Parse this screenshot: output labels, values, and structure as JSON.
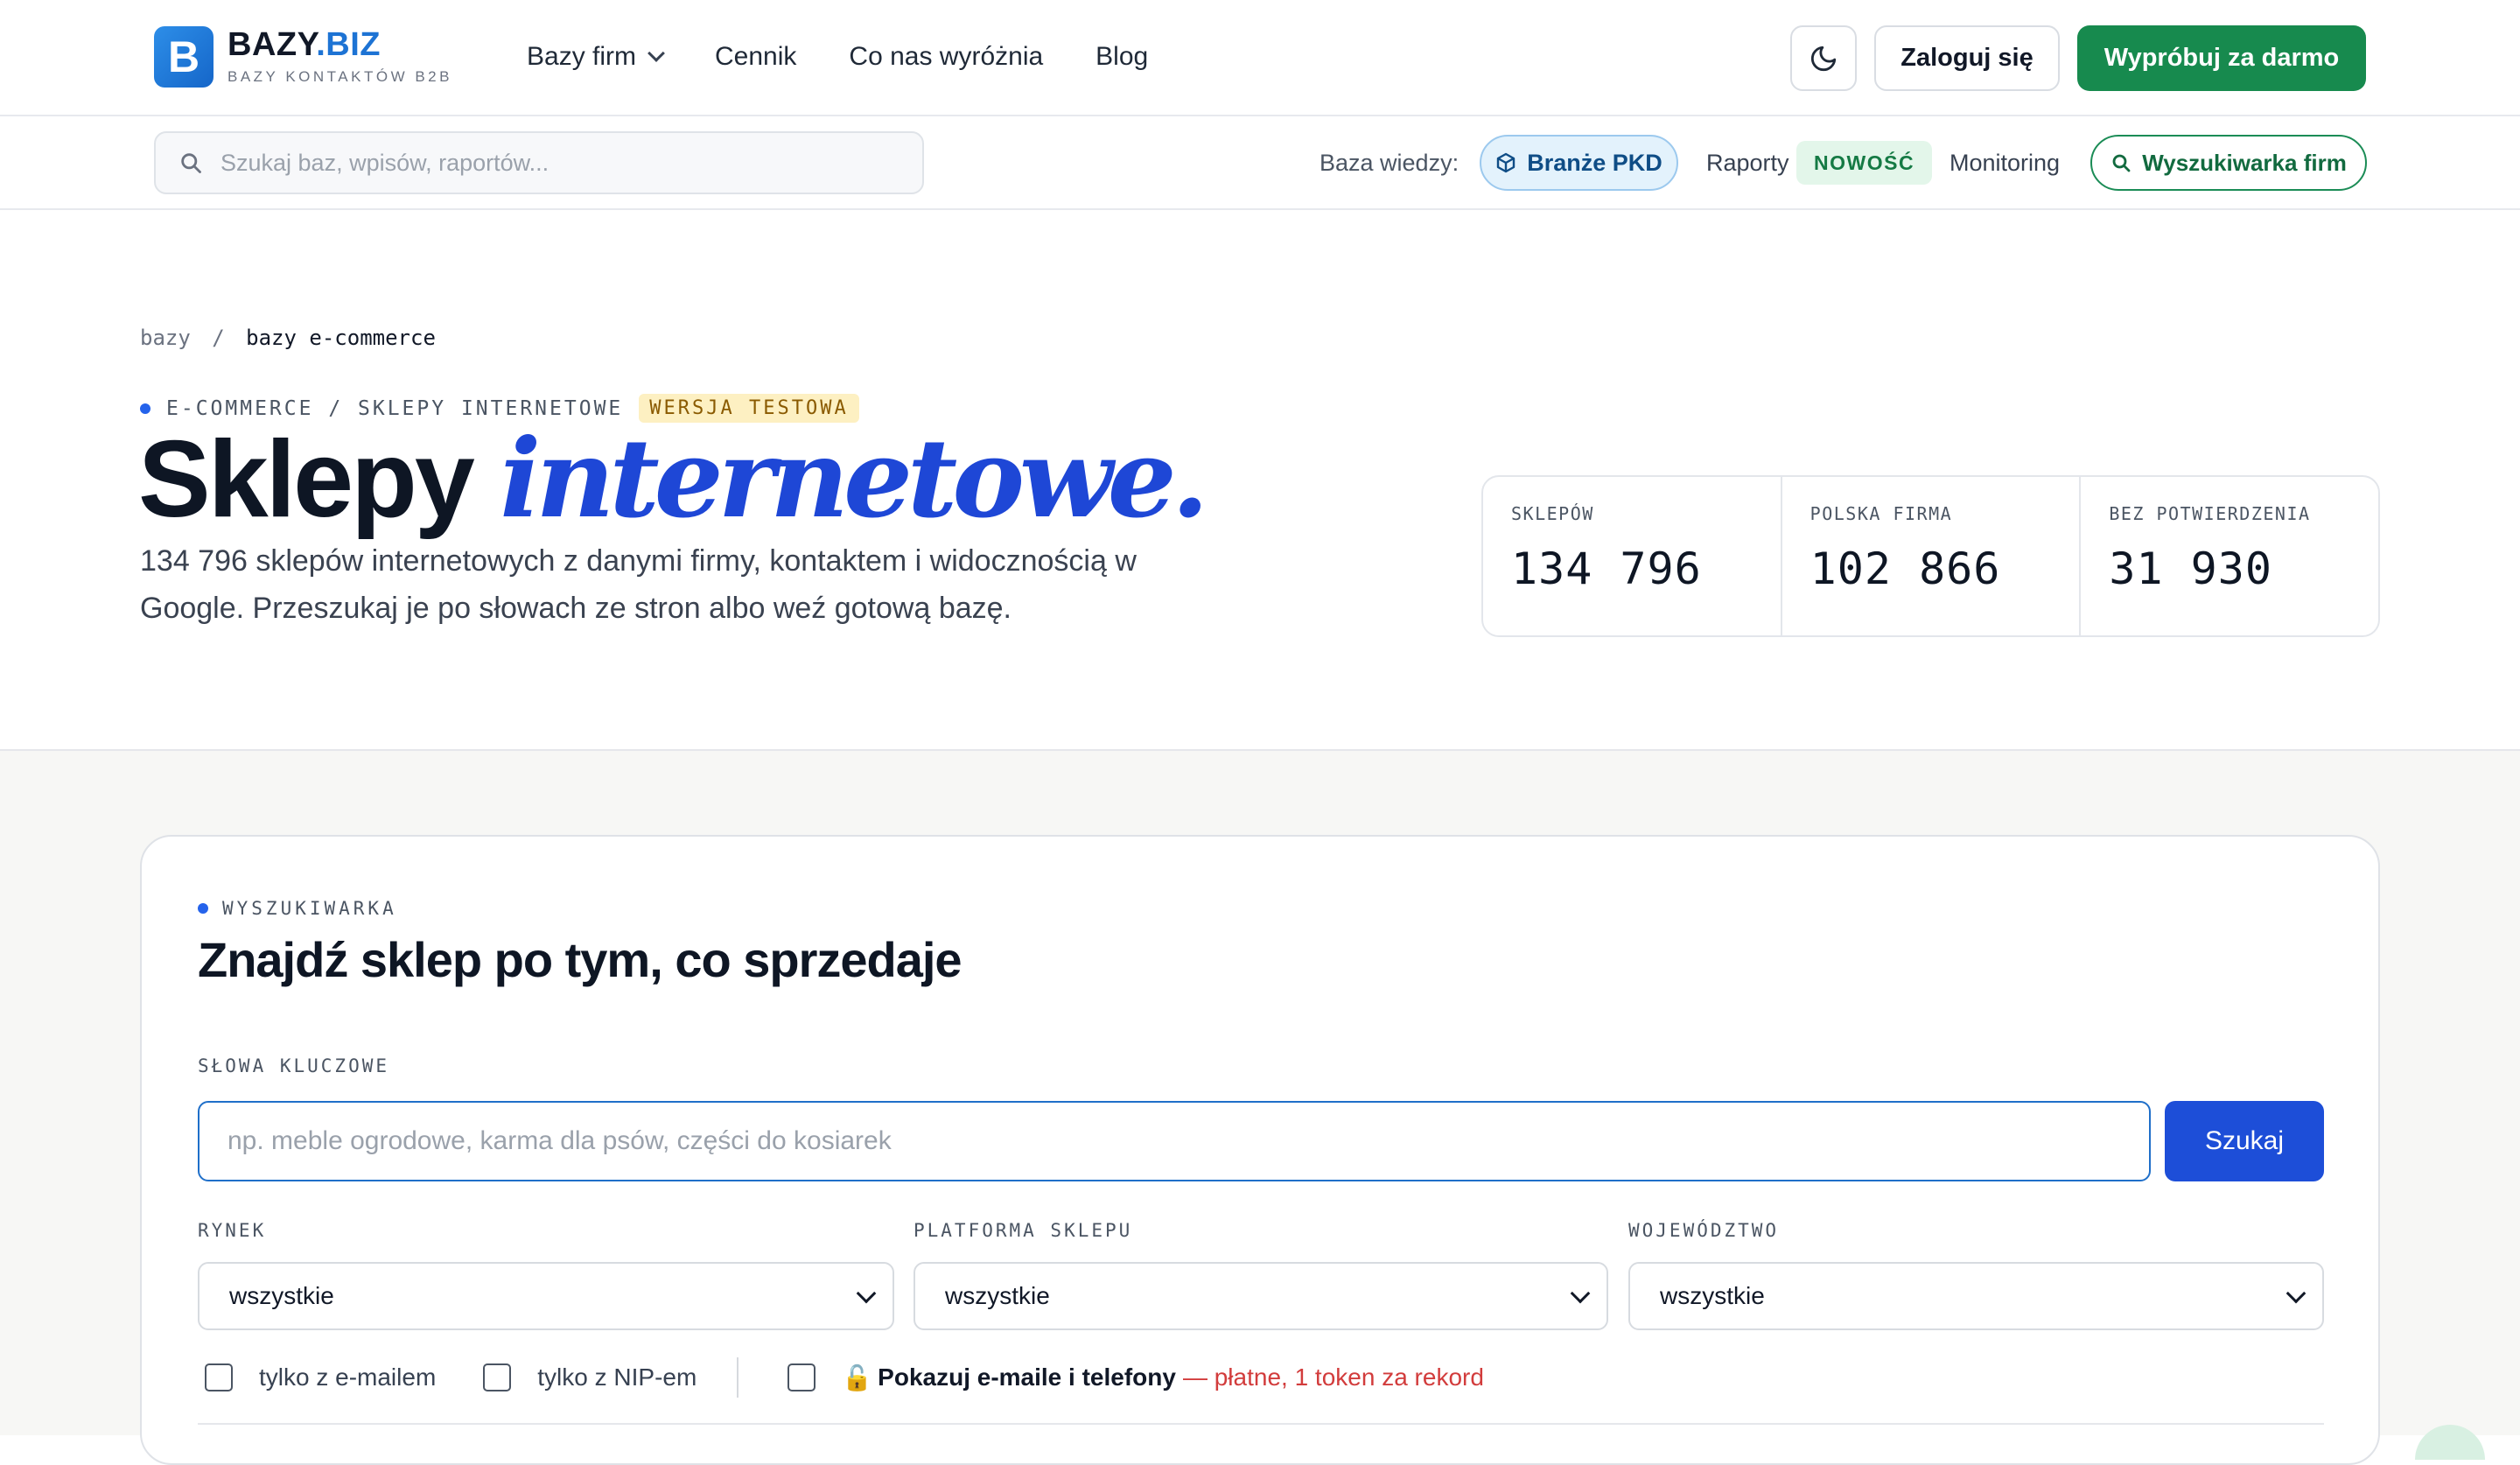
{
  "header": {
    "logo_letter": "B",
    "logo_name": "BAZY",
    "logo_tld": ".BIZ",
    "logo_sub": "BAZY KONTAKTÓW B2B",
    "nav": [
      {
        "label": "Bazy firm",
        "dropdown": true
      },
      {
        "label": "Cennik"
      },
      {
        "label": "Co nas wyróżnia"
      },
      {
        "label": "Blog"
      }
    ],
    "login_label": "Zaloguj się",
    "trial_label": "Wypróbuj za darmo"
  },
  "subbar": {
    "search_placeholder": "Szukaj baz, wpisów, raportów...",
    "kb_label": "Baza wiedzy:",
    "pkd_label": "Branże PKD",
    "raporty_label": "Raporty",
    "new_badge": "NOWOŚĆ",
    "monitoring_label": "Monitoring",
    "company_search_label": "Wyszukiwarka firm"
  },
  "hero": {
    "breadcrumb": {
      "root": "bazy",
      "sep": "/",
      "current": "bazy e-commerce"
    },
    "eyebrow": "E-COMMERCE / SKLEPY INTERNETOWE",
    "test_badge": "WERSJA TESTOWA",
    "title_plain": "Sklepy",
    "title_accent": "internetowe.",
    "lead": "134 796 sklepów internetowych z danymi firmy, kontaktem i widocznością w Google. Przeszukaj je po słowach ze stron albo weź gotową bazę.",
    "stats": [
      {
        "label": "SKLEPÓW",
        "value": "134 796"
      },
      {
        "label": "POLSKA FIRMA",
        "value": "102 866"
      },
      {
        "label": "BEZ POTWIERDZENIA",
        "value": "31 930"
      }
    ]
  },
  "search": {
    "eyebrow": "WYSZUKIWARKA",
    "title": "Znajdź sklep po tym, co sprzedaje",
    "kw_label": "SŁOWA KLUCZOWE",
    "kw_placeholder": "np. meble ogrodowe, karma dla psów, części do kosiarek",
    "submit_label": "Szukaj",
    "filters": [
      {
        "label": "RYNEK",
        "value": "wszystkie"
      },
      {
        "label": "PLATFORMA SKLEPU",
        "value": "wszystkie"
      },
      {
        "label": "WOJEWÓDZTWO",
        "value": "wszystkie"
      }
    ],
    "checks": {
      "email_only": "tylko z e-mailem",
      "nip_only": "tylko z NIP-em",
      "show_contacts": "Pokazuj e-maile i telefony",
      "paid_note": "— płatne, 1 token za rekord",
      "lock_icon": "🔓"
    }
  },
  "colors": {
    "brand_green": "#178a4e",
    "accent_blue": "#1e47d6",
    "button_blue": "#1d4ed8",
    "paid_red": "#d23c3c"
  }
}
